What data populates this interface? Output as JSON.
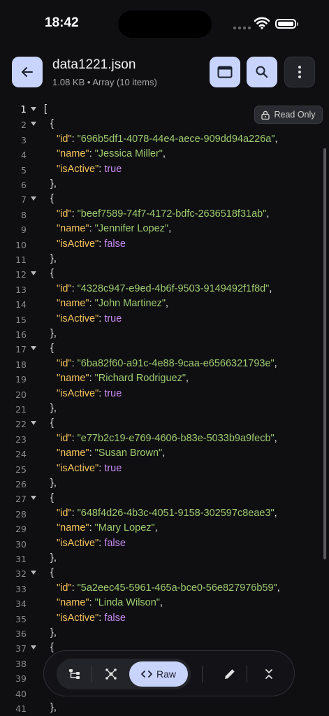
{
  "status": {
    "time": "18:42"
  },
  "header": {
    "title": "data1221.json",
    "subtitle": "1.08 KB • Array (10 items)",
    "icons": {
      "back": "arrow-left-icon",
      "layout": "window-icon",
      "search": "search-icon",
      "more": "more-vertical-icon"
    }
  },
  "badge": {
    "label": "Read Only",
    "icon": "lock-icon"
  },
  "colors": {
    "key": "#f4c25b",
    "string": "#9ecb6f",
    "boolean": "#c98cf2",
    "accent": "#c8d4fb",
    "background": "#0f0f12"
  },
  "lines": [
    {
      "n": "1",
      "indent": 0,
      "fold": true,
      "tokens": [
        [
          "punc",
          "["
        ]
      ]
    },
    {
      "n": "2",
      "indent": 1,
      "fold": true,
      "tokens": [
        [
          "punc",
          "{"
        ]
      ]
    },
    {
      "n": "3",
      "indent": 2,
      "tokens": [
        [
          "key",
          "\"id\""
        ],
        [
          "punc",
          ": "
        ],
        [
          "str",
          "\"696b5df1-4078-44e4-aece-909dd94a226a\""
        ],
        [
          "punc",
          ","
        ]
      ]
    },
    {
      "n": "4",
      "indent": 2,
      "tokens": [
        [
          "key",
          "\"name\""
        ],
        [
          "punc",
          ": "
        ],
        [
          "str",
          "\"Jessica Miller\""
        ],
        [
          "punc",
          ","
        ]
      ]
    },
    {
      "n": "5",
      "indent": 2,
      "tokens": [
        [
          "key",
          "\"isActive\""
        ],
        [
          "punc",
          ": "
        ],
        [
          "bool",
          "true"
        ]
      ]
    },
    {
      "n": "6",
      "indent": 1,
      "tokens": [
        [
          "punc",
          "},"
        ]
      ]
    },
    {
      "n": "7",
      "indent": 1,
      "fold": true,
      "tokens": [
        [
          "punc",
          "{"
        ]
      ]
    },
    {
      "n": "8",
      "indent": 2,
      "tokens": [
        [
          "key",
          "\"id\""
        ],
        [
          "punc",
          ": "
        ],
        [
          "str",
          "\"beef7589-74f7-4172-bdfc-2636518f31ab\""
        ],
        [
          "punc",
          ","
        ]
      ]
    },
    {
      "n": "9",
      "indent": 2,
      "tokens": [
        [
          "key",
          "\"name\""
        ],
        [
          "punc",
          ": "
        ],
        [
          "str",
          "\"Jennifer Lopez\""
        ],
        [
          "punc",
          ","
        ]
      ]
    },
    {
      "n": "10",
      "indent": 2,
      "tokens": [
        [
          "key",
          "\"isActive\""
        ],
        [
          "punc",
          ": "
        ],
        [
          "bool",
          "false"
        ]
      ]
    },
    {
      "n": "11",
      "indent": 1,
      "tokens": [
        [
          "punc",
          "},"
        ]
      ]
    },
    {
      "n": "12",
      "indent": 1,
      "fold": true,
      "tokens": [
        [
          "punc",
          "{"
        ]
      ]
    },
    {
      "n": "13",
      "indent": 2,
      "tokens": [
        [
          "key",
          "\"id\""
        ],
        [
          "punc",
          ": "
        ],
        [
          "str",
          "\"4328c947-e9ed-4b6f-9503-9149492f1f8d\""
        ],
        [
          "punc",
          ","
        ]
      ]
    },
    {
      "n": "14",
      "indent": 2,
      "tokens": [
        [
          "key",
          "\"name\""
        ],
        [
          "punc",
          ": "
        ],
        [
          "str",
          "\"John Martinez\""
        ],
        [
          "punc",
          ","
        ]
      ]
    },
    {
      "n": "15",
      "indent": 2,
      "tokens": [
        [
          "key",
          "\"isActive\""
        ],
        [
          "punc",
          ": "
        ],
        [
          "bool",
          "true"
        ]
      ]
    },
    {
      "n": "16",
      "indent": 1,
      "tokens": [
        [
          "punc",
          "},"
        ]
      ]
    },
    {
      "n": "17",
      "indent": 1,
      "fold": true,
      "tokens": [
        [
          "punc",
          "{"
        ]
      ]
    },
    {
      "n": "18",
      "indent": 2,
      "tokens": [
        [
          "key",
          "\"id\""
        ],
        [
          "punc",
          ": "
        ],
        [
          "str",
          "\"6ba82f60-a91c-4e88-9caa-e6566321793e\""
        ],
        [
          "punc",
          ","
        ]
      ]
    },
    {
      "n": "19",
      "indent": 2,
      "tokens": [
        [
          "key",
          "\"name\""
        ],
        [
          "punc",
          ": "
        ],
        [
          "str",
          "\"Richard Rodriguez\""
        ],
        [
          "punc",
          ","
        ]
      ]
    },
    {
      "n": "20",
      "indent": 2,
      "tokens": [
        [
          "key",
          "\"isActive\""
        ],
        [
          "punc",
          ": "
        ],
        [
          "bool",
          "true"
        ]
      ]
    },
    {
      "n": "21",
      "indent": 1,
      "tokens": [
        [
          "punc",
          "},"
        ]
      ]
    },
    {
      "n": "22",
      "indent": 1,
      "fold": true,
      "tokens": [
        [
          "punc",
          "{"
        ]
      ]
    },
    {
      "n": "23",
      "indent": 2,
      "tokens": [
        [
          "key",
          "\"id\""
        ],
        [
          "punc",
          ": "
        ],
        [
          "str",
          "\"e77b2c19-e769-4606-b83e-5033b9a9fecb\""
        ],
        [
          "punc",
          ","
        ]
      ]
    },
    {
      "n": "24",
      "indent": 2,
      "tokens": [
        [
          "key",
          "\"name\""
        ],
        [
          "punc",
          ": "
        ],
        [
          "str",
          "\"Susan Brown\""
        ],
        [
          "punc",
          ","
        ]
      ]
    },
    {
      "n": "25",
      "indent": 2,
      "tokens": [
        [
          "key",
          "\"isActive\""
        ],
        [
          "punc",
          ": "
        ],
        [
          "bool",
          "true"
        ]
      ]
    },
    {
      "n": "26",
      "indent": 1,
      "tokens": [
        [
          "punc",
          "},"
        ]
      ]
    },
    {
      "n": "27",
      "indent": 1,
      "fold": true,
      "tokens": [
        [
          "punc",
          "{"
        ]
      ]
    },
    {
      "n": "28",
      "indent": 2,
      "tokens": [
        [
          "key",
          "\"id\""
        ],
        [
          "punc",
          ": "
        ],
        [
          "str",
          "\"648f4d26-4b3c-4051-9158-302597c8eae3\""
        ],
        [
          "punc",
          ","
        ]
      ]
    },
    {
      "n": "29",
      "indent": 2,
      "tokens": [
        [
          "key",
          "\"name\""
        ],
        [
          "punc",
          ": "
        ],
        [
          "str",
          "\"Mary Lopez\""
        ],
        [
          "punc",
          ","
        ]
      ]
    },
    {
      "n": "30",
      "indent": 2,
      "tokens": [
        [
          "key",
          "\"isActive\""
        ],
        [
          "punc",
          ": "
        ],
        [
          "bool",
          "false"
        ]
      ]
    },
    {
      "n": "31",
      "indent": 1,
      "tokens": [
        [
          "punc",
          "},"
        ]
      ]
    },
    {
      "n": "32",
      "indent": 1,
      "fold": true,
      "tokens": [
        [
          "punc",
          "{"
        ]
      ]
    },
    {
      "n": "33",
      "indent": 2,
      "tokens": [
        [
          "key",
          "\"id\""
        ],
        [
          "punc",
          ": "
        ],
        [
          "str",
          "\"5a2eec45-5961-465a-bce0-56e827976b59\""
        ],
        [
          "punc",
          ","
        ]
      ]
    },
    {
      "n": "34",
      "indent": 2,
      "tokens": [
        [
          "key",
          "\"name\""
        ],
        [
          "punc",
          ": "
        ],
        [
          "str",
          "\"Linda Wilson\""
        ],
        [
          "punc",
          ","
        ]
      ]
    },
    {
      "n": "35",
      "indent": 2,
      "tokens": [
        [
          "key",
          "\"isActive\""
        ],
        [
          "punc",
          ": "
        ],
        [
          "bool",
          "false"
        ]
      ]
    },
    {
      "n": "36",
      "indent": 1,
      "tokens": [
        [
          "punc",
          "},"
        ]
      ]
    },
    {
      "n": "37",
      "indent": 1,
      "fold": true,
      "tokens": [
        [
          "punc",
          "{"
        ]
      ]
    },
    {
      "n": "38",
      "indent": 2,
      "tokens": []
    },
    {
      "n": "39",
      "indent": 2,
      "tokens": []
    },
    {
      "n": "40",
      "indent": 2,
      "tokens": []
    },
    {
      "n": "41",
      "indent": 1,
      "tokens": [
        [
          "punc",
          "},"
        ]
      ]
    }
  ],
  "bottom_bar": {
    "tree_icon": "tree-view-icon",
    "graph_icon": "graph-view-icon",
    "raw_label": "Raw",
    "raw_icon": "code-icon",
    "edit_icon": "pencil-icon",
    "collapse_icon": "collapse-icon"
  }
}
